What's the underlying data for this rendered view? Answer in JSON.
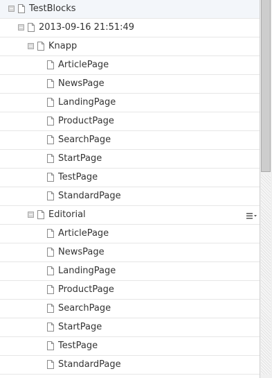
{
  "tree": {
    "nodes": [
      {
        "label": "TestBlocks",
        "depth": 0,
        "expanded": true,
        "icon": "page-icon"
      },
      {
        "label": "2013-09-16 21:51:49",
        "depth": 1,
        "expanded": true,
        "icon": "page-icon"
      },
      {
        "label": "Knapp",
        "depth": 2,
        "expanded": true,
        "icon": "page-icon"
      },
      {
        "label": "ArticlePage",
        "depth": 3,
        "expanded": null,
        "icon": "page-icon"
      },
      {
        "label": "NewsPage",
        "depth": 3,
        "expanded": null,
        "icon": "page-icon"
      },
      {
        "label": "LandingPage",
        "depth": 3,
        "expanded": null,
        "icon": "page-icon"
      },
      {
        "label": "ProductPage",
        "depth": 3,
        "expanded": null,
        "icon": "page-icon"
      },
      {
        "label": "SearchPage",
        "depth": 3,
        "expanded": null,
        "icon": "page-icon"
      },
      {
        "label": "StartPage",
        "depth": 3,
        "expanded": null,
        "icon": "page-icon"
      },
      {
        "label": "TestPage",
        "depth": 3,
        "expanded": null,
        "icon": "page-icon"
      },
      {
        "label": "StandardPage",
        "depth": 3,
        "expanded": null,
        "icon": "page-icon"
      },
      {
        "label": "Editorial",
        "depth": 2,
        "expanded": true,
        "icon": "page-icon",
        "context_menu_icon": "context-menu-icon"
      },
      {
        "label": "ArticlePage",
        "depth": 3,
        "expanded": null,
        "icon": "page-icon"
      },
      {
        "label": "NewsPage",
        "depth": 3,
        "expanded": null,
        "icon": "page-icon"
      },
      {
        "label": "LandingPage",
        "depth": 3,
        "expanded": null,
        "icon": "page-icon"
      },
      {
        "label": "ProductPage",
        "depth": 3,
        "expanded": null,
        "icon": "page-icon"
      },
      {
        "label": "SearchPage",
        "depth": 3,
        "expanded": null,
        "icon": "page-icon"
      },
      {
        "label": "StartPage",
        "depth": 3,
        "expanded": null,
        "icon": "page-icon"
      },
      {
        "label": "TestPage",
        "depth": 3,
        "expanded": null,
        "icon": "page-icon"
      },
      {
        "label": "StandardPage",
        "depth": 3,
        "expanded": null,
        "icon": "page-icon"
      }
    ]
  },
  "colors": {
    "row_divider": "#e6e6e6",
    "text": "#333333",
    "icon_stroke": "#8a8a8a",
    "expander_fill": "#d9d9d9",
    "scrollbar_thumb": "#cdcdcd"
  },
  "scrollbar": {
    "scroll_position_fraction": 0.0,
    "visible_fraction": 0.46
  }
}
